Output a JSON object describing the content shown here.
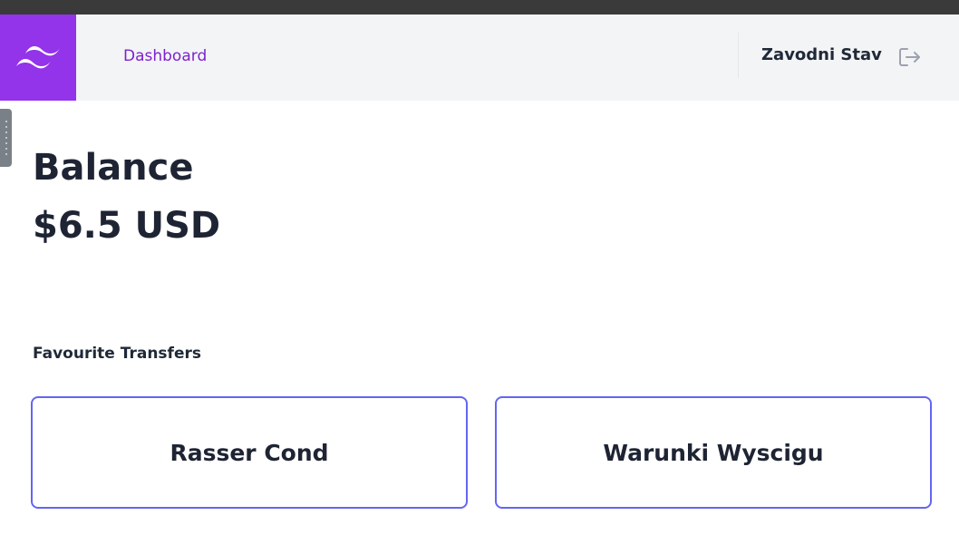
{
  "nav": {
    "link_label": "Dashboard",
    "user_name": "Zavodni Stav",
    "brand_color": "#9333ea",
    "link_color": "#7e22ce"
  },
  "balance": {
    "title": "Balance",
    "amount": "$6.5 USD"
  },
  "favourites": {
    "title": "Favourite Transfers",
    "items": [
      {
        "label": "Rasser Cond"
      },
      {
        "label": "Warunki Wyscigu"
      }
    ],
    "border_color": "#6366f1"
  }
}
